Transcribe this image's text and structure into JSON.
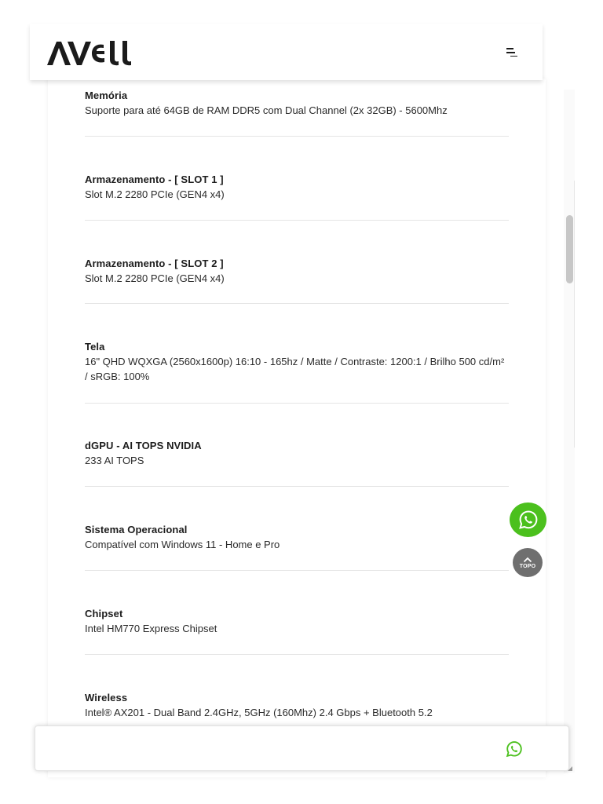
{
  "brand": {
    "name": "AVELL"
  },
  "specs": [
    {
      "label": "Memória",
      "value": "Suporte para até 64GB de RAM DDR5 com Dual Channel (2x 32GB) - 5600Mhz"
    },
    {
      "label": "Armazenamento - [ SLOT 1 ]",
      "value": "Slot M.2 2280 PCIe (GEN4 x4)"
    },
    {
      "label": "Armazenamento - [ SLOT 2 ]",
      "value": "Slot M.2 2280 PCIe (GEN4 x4)"
    },
    {
      "label": "Tela",
      "value": "16\" QHD WQXGA (2560x1600p) 16:10 - 165hz / Matte / Contraste: 1200:1 / Brilho 500 cd/m² / sRGB: 100%"
    },
    {
      "label": "dGPU - AI TOPS NVIDIA",
      "value": "233 AI TOPS"
    },
    {
      "label": "Sistema Operacional",
      "value": "Compatível com Windows 11 - Home e Pro"
    },
    {
      "label": "Chipset",
      "value": "Intel HM770 Express Chipset"
    },
    {
      "label": "Wireless",
      "value": "Intel® AX201 - Dual Band 2.4GHz, 5GHz (160Mhz) 2.4 Gbps + Bluetooth 5.2"
    }
  ],
  "floating": {
    "top_label": "TOPO"
  },
  "icons": {
    "menu": "menu-icon",
    "whatsapp": "whatsapp-icon",
    "top": "chevron-up-icon"
  },
  "colors": {
    "whatsapp_green": "#4bc01d",
    "top_button": "#6f6f6f",
    "text": "#1c1c1c"
  }
}
